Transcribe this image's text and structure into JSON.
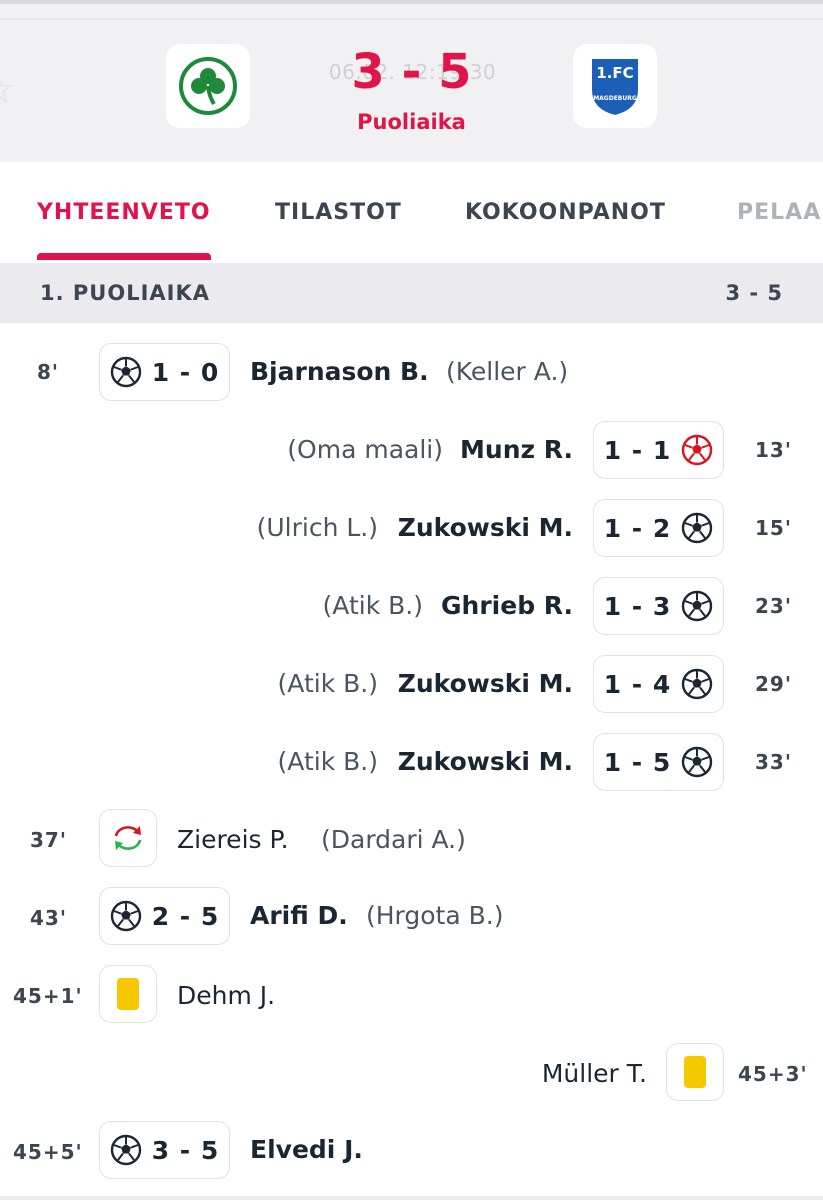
{
  "match": {
    "datetime": "06.02. 12:19:30",
    "score": "3 - 5",
    "status": "Puoliaika",
    "home_team_logo": "clover-logo",
    "away_team_logo": "1fc-magdeburg-logo",
    "away_logo_text_top": "1.FC",
    "away_logo_text_side": "MAGDEBURG"
  },
  "tabs": [
    {
      "label": "YHTEENVETO",
      "active": true
    },
    {
      "label": "TILASTOT",
      "active": false
    },
    {
      "label": "KOKOONPANOT",
      "active": false
    },
    {
      "label": "PELAA",
      "active": false
    }
  ],
  "section": {
    "label": "1. PUOLIAIKA",
    "score": "3 - 5"
  },
  "events": [
    {
      "minute": "8'",
      "side": "home",
      "type": "goal",
      "score": "1 - 0",
      "player": "Bjarnason B.",
      "assist": "(Keller A.)"
    },
    {
      "minute": "13'",
      "side": "away",
      "type": "own-goal",
      "score": "1 - 1",
      "player": "Munz R.",
      "assist": "(Oma maali)"
    },
    {
      "minute": "15'",
      "side": "away",
      "type": "goal",
      "score": "1 - 2",
      "player": "Zukowski M.",
      "assist": "(Ulrich L.)"
    },
    {
      "minute": "23'",
      "side": "away",
      "type": "goal",
      "score": "1 - 3",
      "player": "Ghrieb R.",
      "assist": "(Atik B.)"
    },
    {
      "minute": "29'",
      "side": "away",
      "type": "goal",
      "score": "1 - 4",
      "player": "Zukowski M.",
      "assist": "(Atik B.)"
    },
    {
      "minute": "33'",
      "side": "away",
      "type": "goal",
      "score": "1 - 5",
      "player": "Zukowski M.",
      "assist": "(Atik B.)"
    },
    {
      "minute": "37'",
      "side": "home",
      "type": "substitution",
      "player": "Ziereis P.",
      "assist": "(Dardari A.)"
    },
    {
      "minute": "43'",
      "side": "home",
      "type": "goal",
      "score": "2 - 5",
      "player": "Arifi D.",
      "assist": "(Hrgota B.)"
    },
    {
      "minute": "45+1'",
      "side": "home",
      "type": "yellow-card",
      "player": "Dehm J."
    },
    {
      "minute": "45+3'",
      "side": "away",
      "type": "yellow-card",
      "player": "Müller T."
    },
    {
      "minute": "45+5'",
      "side": "home",
      "type": "goal",
      "score": "3 - 5",
      "player": "Elvedi J."
    }
  ],
  "colors": {
    "accent": "#e0144a",
    "yellow_card": "#f6c800",
    "own_goal": "#d8141c",
    "sub_in": "#2ab34a",
    "sub_out": "#d8141c"
  }
}
